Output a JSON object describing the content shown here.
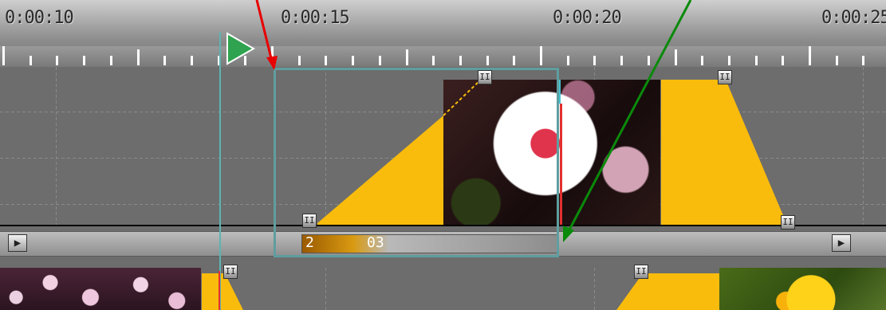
{
  "ruler": {
    "labels": [
      "0:00:10",
      "0:00:15",
      "0:00:20",
      "0:00:25"
    ]
  },
  "scroll_bar": {
    "left_arrow": "▶",
    "right_arrow": "▶"
  },
  "clip_progress": {
    "index": "2",
    "frame": "03"
  },
  "keyframe_handle_text": "II",
  "colors": {
    "envelope": "#f9bc0c",
    "selection": "#5f9ea0",
    "annotation_red": "#e80000",
    "annotation_green": "#0a8a0a",
    "playhead": "#e23030",
    "play_button": "#2fa34f"
  },
  "icons": [
    "play-icon",
    "scroll-right-arrow-icon",
    "keyframe-handle-icon"
  ]
}
